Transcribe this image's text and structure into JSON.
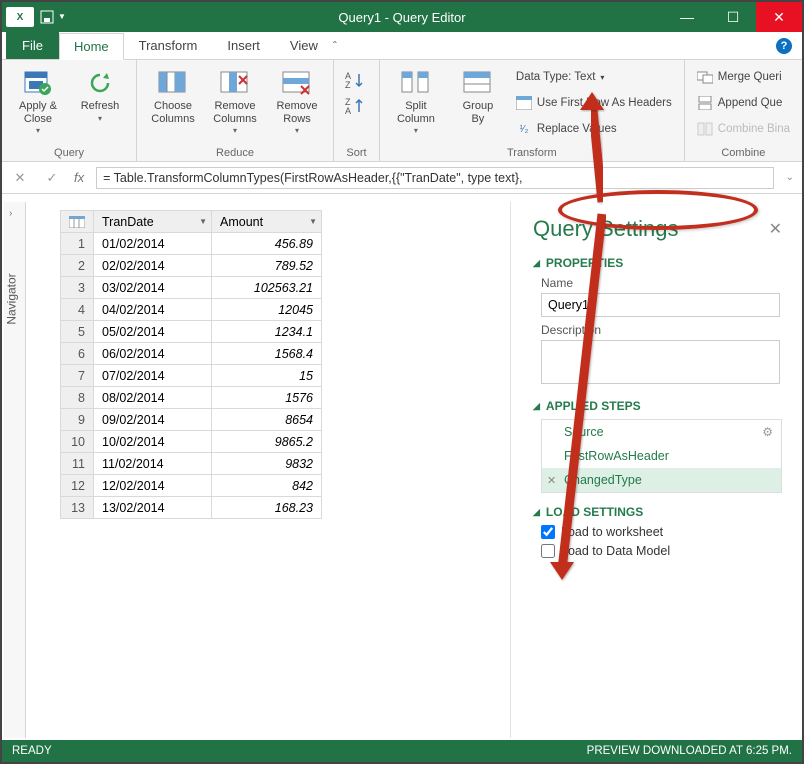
{
  "window": {
    "title": "Query1 - Query Editor"
  },
  "tabs": {
    "file": "File",
    "home": "Home",
    "transform": "Transform",
    "insert": "Insert",
    "view": "View"
  },
  "ribbon": {
    "query": {
      "label": "Query",
      "apply_close": "Apply &\nClose",
      "refresh": "Refresh"
    },
    "reduce": {
      "label": "Reduce",
      "choose": "Choose\nColumns",
      "remove_cols": "Remove\nColumns",
      "remove_rows": "Remove\nRows"
    },
    "sort": {
      "label": "Sort"
    },
    "transform": {
      "label": "Transform",
      "split": "Split\nColumn",
      "group": "Group\nBy",
      "datatype": "Data Type: Text",
      "firstrow": "Use First Row As Headers",
      "replace": "Replace Values"
    },
    "combine": {
      "label": "Combine",
      "merge": "Merge Queri",
      "append": "Append Que",
      "combine_bin": "Combine Bina"
    }
  },
  "formula": {
    "text": "= Table.TransformColumnTypes(FirstRowAsHeader,{{\"TranDate\", type text},"
  },
  "navigator": "Navigator",
  "grid": {
    "columns": [
      "TranDate",
      "Amount"
    ],
    "rows": [
      {
        "n": 1,
        "d": "01/02/2014",
        "a": "456.89"
      },
      {
        "n": 2,
        "d": "02/02/2014",
        "a": "789.52"
      },
      {
        "n": 3,
        "d": "03/02/2014",
        "a": "102563.21"
      },
      {
        "n": 4,
        "d": "04/02/2014",
        "a": "12045"
      },
      {
        "n": 5,
        "d": "05/02/2014",
        "a": "1234.1"
      },
      {
        "n": 6,
        "d": "06/02/2014",
        "a": "1568.4"
      },
      {
        "n": 7,
        "d": "07/02/2014",
        "a": "15"
      },
      {
        "n": 8,
        "d": "08/02/2014",
        "a": "1576"
      },
      {
        "n": 9,
        "d": "09/02/2014",
        "a": "8654"
      },
      {
        "n": 10,
        "d": "10/02/2014",
        "a": "9865.2"
      },
      {
        "n": 11,
        "d": "11/02/2014",
        "a": "9832"
      },
      {
        "n": 12,
        "d": "12/02/2014",
        "a": "842"
      },
      {
        "n": 13,
        "d": "13/02/2014",
        "a": "168.23"
      }
    ]
  },
  "settings": {
    "title": "Query Settings",
    "properties": "PROPERTIES",
    "name_label": "Name",
    "name_value": "Query1",
    "desc_label": "Description",
    "applied": "APPLIED STEPS",
    "steps": [
      "Source",
      "FirstRowAsHeader",
      "ChangedType"
    ],
    "load": "LOAD SETTINGS",
    "load_ws": "Load to worksheet",
    "load_dm": "Load to Data Model"
  },
  "status": {
    "left": "READY",
    "right": "PREVIEW DOWNLOADED AT 6:25 PM."
  }
}
